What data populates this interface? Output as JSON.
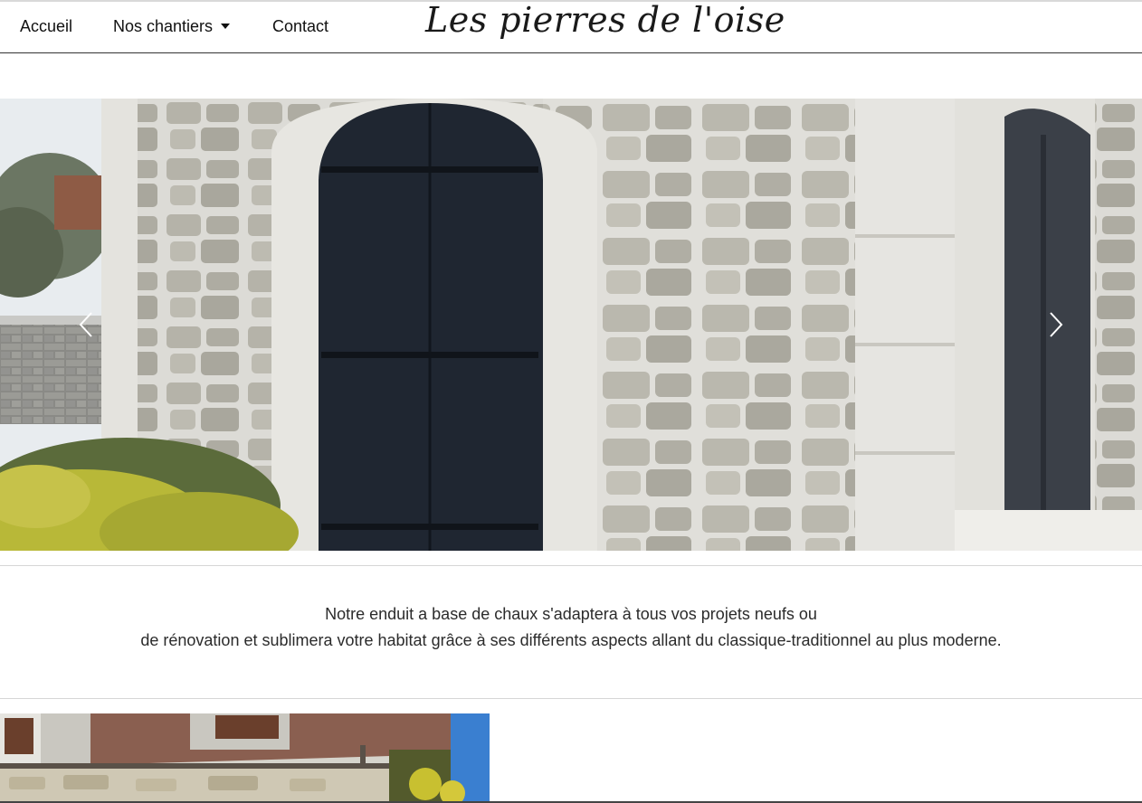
{
  "nav": {
    "items": [
      {
        "label": "Accueil"
      },
      {
        "label": "Nos chantiers",
        "has_dropdown": true
      },
      {
        "label": "Contact"
      }
    ],
    "brand": "Les pierres de l'oise"
  },
  "carousel": {
    "prev_icon": "chevron-left-icon",
    "next_icon": "chevron-right-icon"
  },
  "intro": {
    "line1": "Notre enduit a base de chaux s'adaptera à tous vos projets neufs ou",
    "line2": "de rénovation et sublimera votre habitat grâce à ses différents aspects allant du classique-traditionnel au plus moderne."
  },
  "colors": {
    "door": "#1e2530",
    "wall": "#d9d8d3",
    "stone": "#b9b7ad",
    "sky": "#3a7fd0"
  }
}
